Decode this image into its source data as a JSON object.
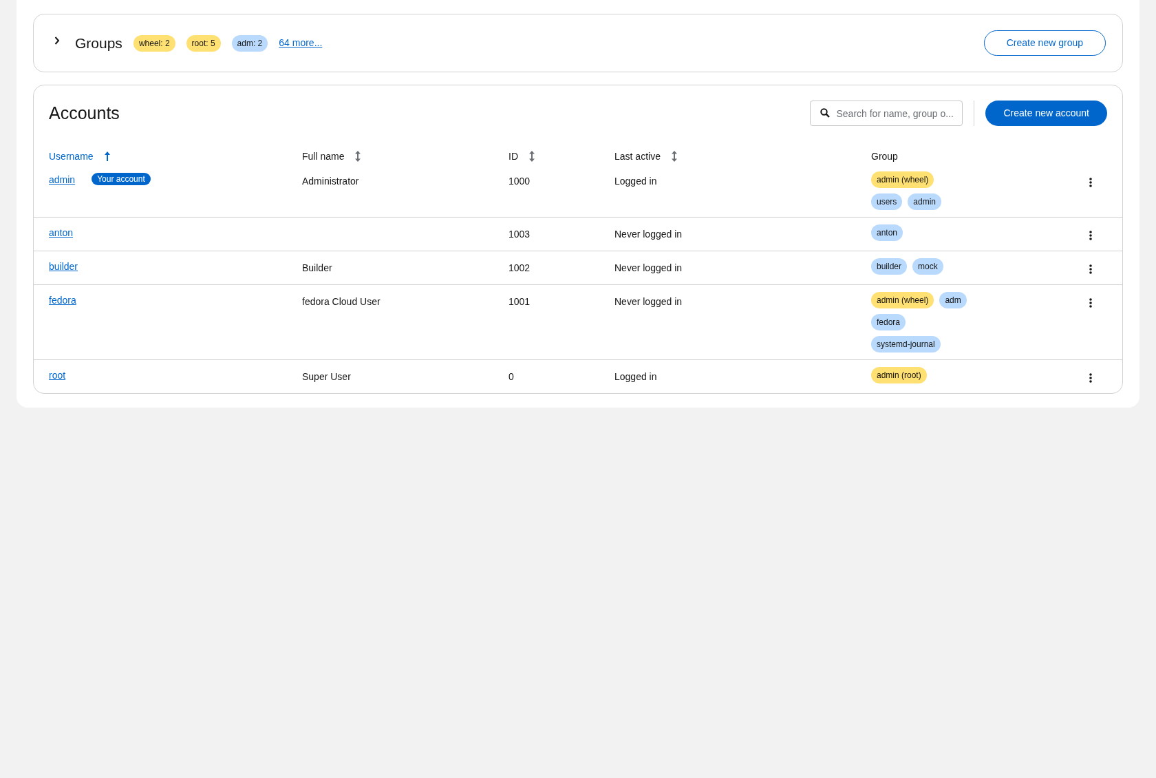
{
  "groups_section": {
    "title": "Groups",
    "expanded": false,
    "labels": [
      {
        "text": "wheel: 2",
        "color": "#ffe072"
      },
      {
        "text": "root: 5",
        "color": "#ffe072"
      },
      {
        "text": "adm: 2",
        "color": "#b9dafc"
      }
    ],
    "more_link": "64 more...",
    "create_button": "Create new group"
  },
  "accounts": {
    "title": "Accounts",
    "search": {
      "placeholder": "Search for name, group o..."
    },
    "create_button": "Create new account",
    "columns": [
      {
        "label": "Username",
        "sortable": true,
        "sorted": true
      },
      {
        "label": "Full name",
        "sortable": true,
        "sorted": false
      },
      {
        "label": "ID",
        "sortable": true,
        "sorted": false
      },
      {
        "label": "Last active",
        "sortable": true,
        "sorted": false
      },
      {
        "label": "Group"
      }
    ],
    "rows": [
      {
        "username": "admin",
        "badge": "Your account",
        "full_name": "Administrator",
        "id": "1000",
        "last_active": "Logged in",
        "groups": [
          {
            "text": "admin (wheel)",
            "color": "#ffe072"
          },
          {
            "text": "users",
            "color": "#b9dafc"
          },
          {
            "text": "admin",
            "color": "#b9dafc"
          }
        ]
      },
      {
        "username": "anton",
        "full_name": "",
        "id": "1003",
        "last_active": "Never logged in",
        "groups": [
          {
            "text": "anton",
            "color": "#b9dafc"
          }
        ]
      },
      {
        "username": "builder",
        "full_name": "Builder",
        "id": "1002",
        "last_active": "Never logged in",
        "groups": [
          {
            "text": "builder",
            "color": "#b9dafc"
          },
          {
            "text": "mock",
            "color": "#b9dafc"
          }
        ]
      },
      {
        "username": "fedora",
        "full_name": "fedora Cloud User",
        "id": "1001",
        "last_active": "Never logged in",
        "groups": [
          {
            "text": "admin (wheel)",
            "color": "#ffe072"
          },
          {
            "text": "adm",
            "color": "#b9dafc"
          },
          {
            "text": "fedora",
            "color": "#b9dafc"
          },
          {
            "text": "systemd-journal",
            "color": "#b9dafc"
          }
        ]
      },
      {
        "username": "root",
        "full_name": "Super User",
        "id": "0",
        "last_active": "Logged in",
        "groups": [
          {
            "text": "admin (root)",
            "color": "#ffe072"
          }
        ]
      }
    ]
  }
}
